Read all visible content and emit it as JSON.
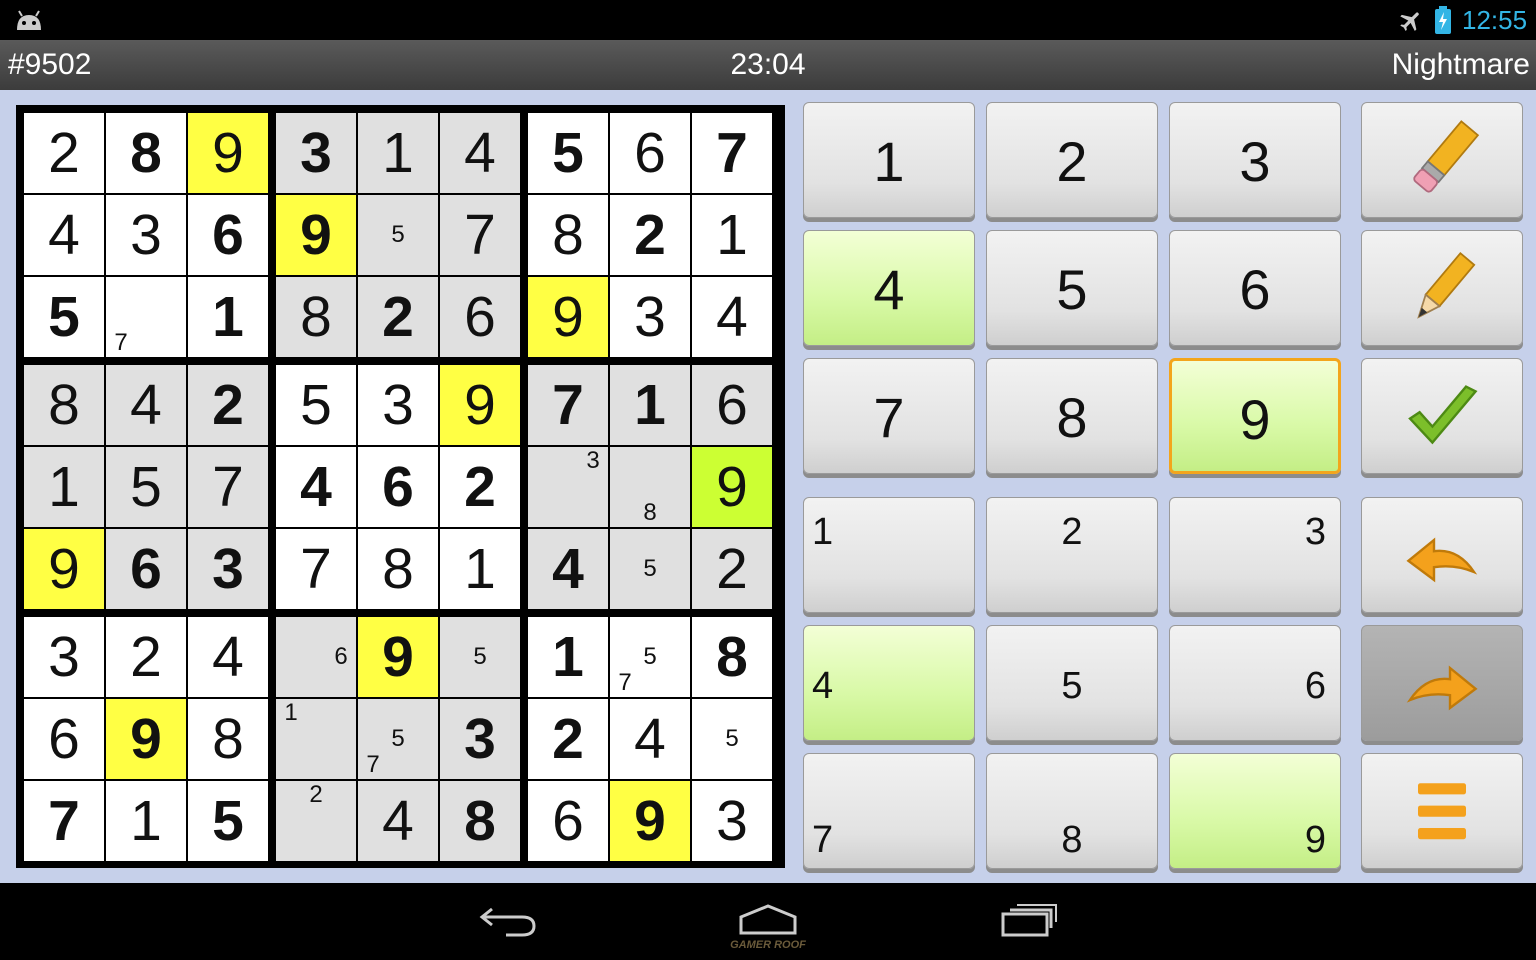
{
  "status_bar": {
    "time": "12:55",
    "icons": [
      "android-icon",
      "airplane-icon",
      "battery-charging-icon"
    ]
  },
  "info_bar": {
    "puzzle_id": "#9502",
    "timer": "23:04",
    "difficulty": "Nightmare"
  },
  "colors": {
    "white_cell": "#ffffff",
    "gray_cell": "#e0e0e0",
    "highlight": "#ffff44",
    "selected_cell": "#ccff33",
    "button_green": "#d8f9a6",
    "selected_border": "#f3a51c",
    "clock": "#33b5e5"
  },
  "board": {
    "rows": [
      [
        {
          "v": "2",
          "g": false,
          "s": "w"
        },
        {
          "v": "8",
          "g": true,
          "s": "w"
        },
        {
          "v": "9",
          "g": false,
          "s": "h"
        },
        {
          "v": "3",
          "g": true,
          "s": "g"
        },
        {
          "v": "1",
          "g": false,
          "s": "g"
        },
        {
          "v": "4",
          "g": false,
          "s": "g"
        },
        {
          "v": "5",
          "g": true,
          "s": "w"
        },
        {
          "v": "6",
          "g": false,
          "s": "w"
        },
        {
          "v": "7",
          "g": true,
          "s": "w"
        }
      ],
      [
        {
          "v": "4",
          "g": false,
          "s": "w"
        },
        {
          "v": "3",
          "g": false,
          "s": "w"
        },
        {
          "v": "6",
          "g": true,
          "s": "w"
        },
        {
          "v": "9",
          "g": true,
          "s": "h"
        },
        {
          "v": "",
          "g": false,
          "s": "g",
          "notes": [
            "5"
          ]
        },
        {
          "v": "7",
          "g": false,
          "s": "g"
        },
        {
          "v": "8",
          "g": false,
          "s": "w"
        },
        {
          "v": "2",
          "g": true,
          "s": "w"
        },
        {
          "v": "1",
          "g": false,
          "s": "w"
        }
      ],
      [
        {
          "v": "5",
          "g": true,
          "s": "w"
        },
        {
          "v": "",
          "g": false,
          "s": "w",
          "notes": [
            "7"
          ]
        },
        {
          "v": "1",
          "g": true,
          "s": "w"
        },
        {
          "v": "8",
          "g": false,
          "s": "g"
        },
        {
          "v": "2",
          "g": true,
          "s": "g"
        },
        {
          "v": "6",
          "g": false,
          "s": "g"
        },
        {
          "v": "9",
          "g": false,
          "s": "h"
        },
        {
          "v": "3",
          "g": false,
          "s": "w"
        },
        {
          "v": "4",
          "g": false,
          "s": "w"
        }
      ],
      [
        {
          "v": "8",
          "g": false,
          "s": "g"
        },
        {
          "v": "4",
          "g": false,
          "s": "g"
        },
        {
          "v": "2",
          "g": true,
          "s": "g"
        },
        {
          "v": "5",
          "g": false,
          "s": "w"
        },
        {
          "v": "3",
          "g": false,
          "s": "w"
        },
        {
          "v": "9",
          "g": false,
          "s": "h"
        },
        {
          "v": "7",
          "g": true,
          "s": "g"
        },
        {
          "v": "1",
          "g": true,
          "s": "g"
        },
        {
          "v": "6",
          "g": false,
          "s": "g"
        }
      ],
      [
        {
          "v": "1",
          "g": false,
          "s": "g"
        },
        {
          "v": "5",
          "g": false,
          "s": "g"
        },
        {
          "v": "7",
          "g": false,
          "s": "g"
        },
        {
          "v": "4",
          "g": true,
          "s": "w"
        },
        {
          "v": "6",
          "g": true,
          "s": "w"
        },
        {
          "v": "2",
          "g": true,
          "s": "w"
        },
        {
          "v": "",
          "g": false,
          "s": "g",
          "notes": [
            "3"
          ]
        },
        {
          "v": "",
          "g": false,
          "s": "g",
          "notes": [
            "8"
          ]
        },
        {
          "v": "9",
          "g": false,
          "s": "sel"
        }
      ],
      [
        {
          "v": "9",
          "g": false,
          "s": "h"
        },
        {
          "v": "6",
          "g": true,
          "s": "g"
        },
        {
          "v": "3",
          "g": true,
          "s": "g"
        },
        {
          "v": "7",
          "g": false,
          "s": "w"
        },
        {
          "v": "8",
          "g": false,
          "s": "w"
        },
        {
          "v": "1",
          "g": false,
          "s": "w"
        },
        {
          "v": "4",
          "g": true,
          "s": "g"
        },
        {
          "v": "",
          "g": false,
          "s": "g",
          "notes": [
            "5"
          ]
        },
        {
          "v": "2",
          "g": false,
          "s": "g"
        }
      ],
      [
        {
          "v": "3",
          "g": false,
          "s": "w"
        },
        {
          "v": "2",
          "g": false,
          "s": "w"
        },
        {
          "v": "4",
          "g": false,
          "s": "w"
        },
        {
          "v": "",
          "g": false,
          "s": "g",
          "notes": [
            "6"
          ]
        },
        {
          "v": "9",
          "g": true,
          "s": "h"
        },
        {
          "v": "",
          "g": false,
          "s": "g",
          "notes": [
            "5"
          ]
        },
        {
          "v": "1",
          "g": true,
          "s": "w"
        },
        {
          "v": "",
          "g": false,
          "s": "w",
          "notes": [
            "5",
            "7"
          ]
        },
        {
          "v": "8",
          "g": true,
          "s": "w"
        }
      ],
      [
        {
          "v": "6",
          "g": false,
          "s": "w"
        },
        {
          "v": "9",
          "g": true,
          "s": "h"
        },
        {
          "v": "8",
          "g": false,
          "s": "w"
        },
        {
          "v": "",
          "g": false,
          "s": "g",
          "notes": [
            "1"
          ]
        },
        {
          "v": "",
          "g": false,
          "s": "g",
          "notes": [
            "5",
            "7"
          ]
        },
        {
          "v": "3",
          "g": true,
          "s": "g"
        },
        {
          "v": "2",
          "g": true,
          "s": "w"
        },
        {
          "v": "4",
          "g": false,
          "s": "w"
        },
        {
          "v": "",
          "g": false,
          "s": "w",
          "notes": [
            "5"
          ]
        }
      ],
      [
        {
          "v": "7",
          "g": true,
          "s": "w"
        },
        {
          "v": "1",
          "g": false,
          "s": "w"
        },
        {
          "v": "5",
          "g": true,
          "s": "w"
        },
        {
          "v": "",
          "g": false,
          "s": "g",
          "notes": [
            "2"
          ]
        },
        {
          "v": "4",
          "g": false,
          "s": "g"
        },
        {
          "v": "8",
          "g": true,
          "s": "g"
        },
        {
          "v": "6",
          "g": false,
          "s": "w"
        },
        {
          "v": "9",
          "g": true,
          "s": "h"
        },
        {
          "v": "3",
          "g": false,
          "s": "w"
        }
      ]
    ]
  },
  "keypad": {
    "digits": [
      {
        "label": "1",
        "state": "normal"
      },
      {
        "label": "2",
        "state": "normal"
      },
      {
        "label": "3",
        "state": "normal"
      },
      {
        "label": "4",
        "state": "green"
      },
      {
        "label": "5",
        "state": "normal"
      },
      {
        "label": "6",
        "state": "normal"
      },
      {
        "label": "7",
        "state": "normal"
      },
      {
        "label": "8",
        "state": "normal"
      },
      {
        "label": "9",
        "state": "selected"
      }
    ],
    "notes": [
      {
        "label": "1",
        "state": "normal"
      },
      {
        "label": "2",
        "state": "normal"
      },
      {
        "label": "3",
        "state": "normal"
      },
      {
        "label": "4",
        "state": "green"
      },
      {
        "label": "5",
        "state": "normal"
      },
      {
        "label": "6",
        "state": "normal"
      },
      {
        "label": "7",
        "state": "normal"
      },
      {
        "label": "8",
        "state": "normal"
      },
      {
        "label": "9",
        "state": "green"
      }
    ],
    "tools": [
      "eraser-pencil-icon",
      "pencil-icon",
      "check-icon",
      "undo-icon",
      "redo-icon",
      "menu-icon"
    ]
  },
  "nav_bar": {
    "icons": [
      "back-icon",
      "home-icon",
      "recent-apps-icon"
    ],
    "watermark": "GAMER ROOF"
  }
}
